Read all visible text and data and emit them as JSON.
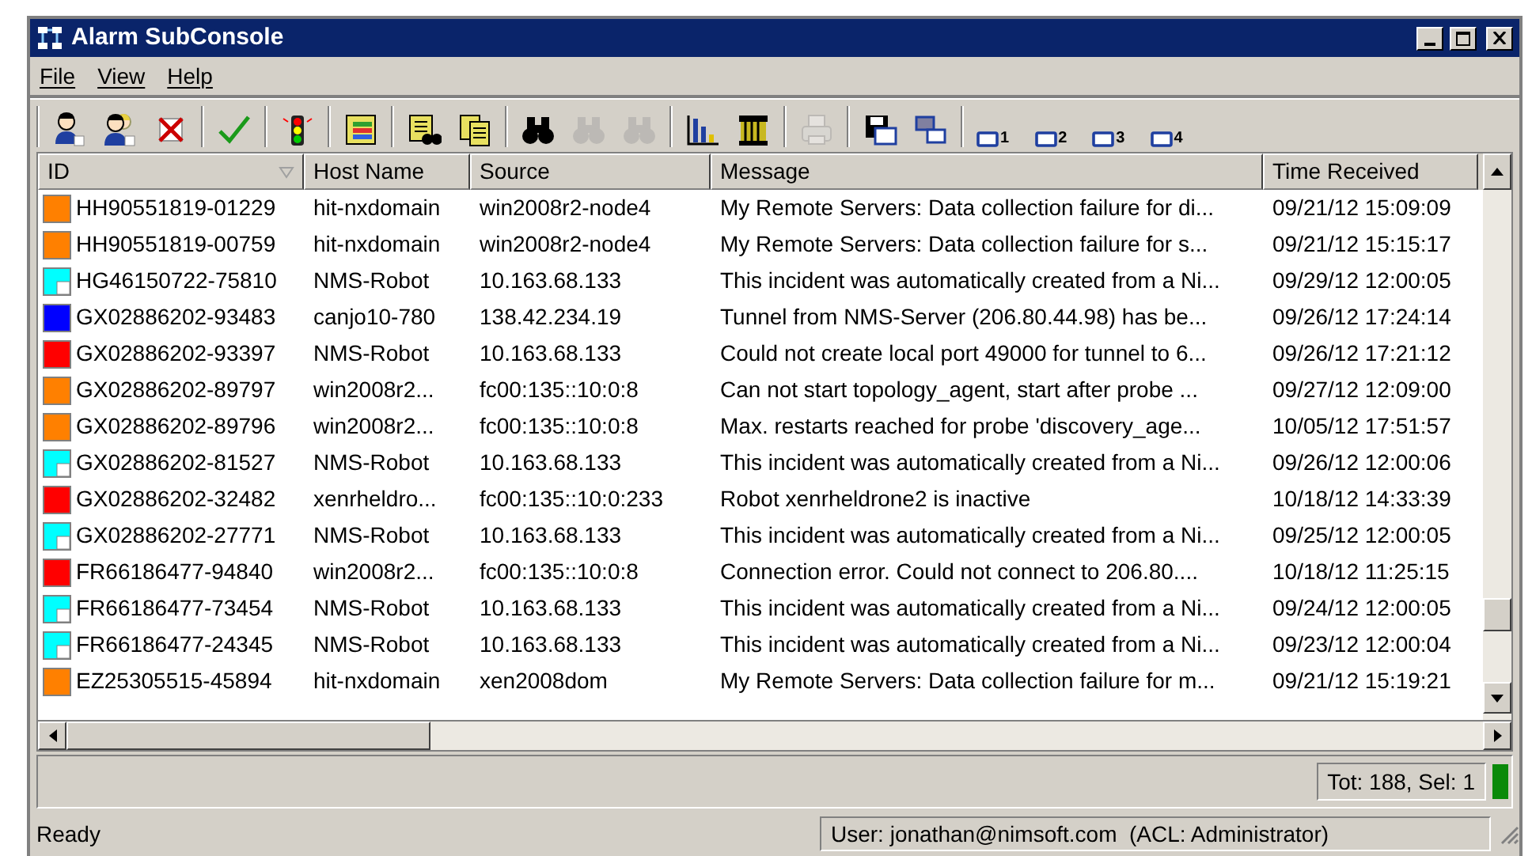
{
  "window": {
    "title": "Alarm SubConsole"
  },
  "menu": [
    "File",
    "View",
    "Help"
  ],
  "toolbar": [
    {
      "kind": "separator"
    },
    {
      "kind": "person",
      "disabled": false
    },
    {
      "kind": "people",
      "disabled": false
    },
    {
      "kind": "delete",
      "disabled": false
    },
    {
      "kind": "separator"
    },
    {
      "kind": "check",
      "disabled": false
    },
    {
      "kind": "separator"
    },
    {
      "kind": "traffic-light",
      "disabled": false
    },
    {
      "kind": "separator"
    },
    {
      "kind": "colored-list",
      "disabled": false
    },
    {
      "kind": "separator"
    },
    {
      "kind": "list-find",
      "disabled": false
    },
    {
      "kind": "lists",
      "disabled": false
    },
    {
      "kind": "separator"
    },
    {
      "kind": "binoculars",
      "disabled": false
    },
    {
      "kind": "binoculars",
      "disabled": true
    },
    {
      "kind": "binoculars",
      "disabled": true
    },
    {
      "kind": "separator"
    },
    {
      "kind": "bar-chart",
      "disabled": false
    },
    {
      "kind": "columns",
      "disabled": false
    },
    {
      "kind": "separator"
    },
    {
      "kind": "printer",
      "disabled": true
    },
    {
      "kind": "separator"
    },
    {
      "kind": "save",
      "disabled": false
    },
    {
      "kind": "windows",
      "disabled": false
    },
    {
      "kind": "separator"
    },
    {
      "kind": "window",
      "disabled": false,
      "label": "1"
    },
    {
      "kind": "window",
      "disabled": false,
      "label": "2"
    },
    {
      "kind": "window",
      "disabled": false,
      "label": "3"
    },
    {
      "kind": "window",
      "disabled": false,
      "label": "4"
    }
  ],
  "table": {
    "columns": [
      {
        "label": "ID",
        "sorted": true
      },
      {
        "label": "Host Name",
        "sorted": false
      },
      {
        "label": "Source",
        "sorted": false
      },
      {
        "label": "Message",
        "sorted": false
      },
      {
        "label": "Time Received",
        "sorted": false
      }
    ],
    "rows": [
      {
        "color": "#ff8000",
        "kind": "plain",
        "cells": [
          "HH90551819-01229",
          "hit-nxdomain",
          "win2008r2-node4",
          "My Remote Servers: Data collection failure for di...",
          "09/21/12 15:09:09"
        ]
      },
      {
        "color": "#ff8000",
        "kind": "plain",
        "cells": [
          "HH90551819-00759",
          "hit-nxdomain",
          "win2008r2-node4",
          "My Remote Servers: Data collection failure for s...",
          "09/21/12 15:15:17"
        ]
      },
      {
        "color": "#00ffff",
        "kind": "cornered",
        "cells": [
          "HG46150722-75810",
          "NMS-Robot",
          "10.163.68.133",
          "This incident was automatically created from a Ni...",
          "09/29/12 12:00:05"
        ]
      },
      {
        "color": "#0000ff",
        "kind": "plain",
        "cells": [
          "GX02886202-93483",
          "canjo10-780",
          "138.42.234.19",
          "Tunnel from NMS-Server (206.80.44.98) has be...",
          "09/26/12 17:24:14"
        ]
      },
      {
        "color": "#ff0000",
        "kind": "plain",
        "cells": [
          "GX02886202-93397",
          "NMS-Robot",
          "10.163.68.133",
          "Could not create local port 49000 for tunnel to 6...",
          "09/26/12 17:21:12"
        ]
      },
      {
        "color": "#ff8000",
        "kind": "plain",
        "cells": [
          "GX02886202-89797",
          "win2008r2...",
          "fc00:135::10:0:8",
          "Can not start topology_agent, start after probe ...",
          "09/27/12 12:09:00"
        ]
      },
      {
        "color": "#ff8000",
        "kind": "plain",
        "cells": [
          "GX02886202-89796",
          "win2008r2...",
          "fc00:135::10:0:8",
          "Max. restarts reached for probe 'discovery_age...",
          "10/05/12 17:51:57"
        ]
      },
      {
        "color": "#00ffff",
        "kind": "cornered",
        "cells": [
          "GX02886202-81527",
          "NMS-Robot",
          "10.163.68.133",
          "This incident was automatically created from a Ni...",
          "09/26/12 12:00:06"
        ]
      },
      {
        "color": "#ff0000",
        "kind": "plain",
        "cells": [
          "GX02886202-32482",
          "xenrheldro...",
          "fc00:135::10:0:233",
          "Robot xenrheldrone2 is inactive",
          "10/18/12 14:33:39"
        ]
      },
      {
        "color": "#00ffff",
        "kind": "cornered",
        "cells": [
          "GX02886202-27771",
          "NMS-Robot",
          "10.163.68.133",
          "This incident was automatically created from a Ni...",
          "09/25/12 12:00:05"
        ]
      },
      {
        "color": "#ff0000",
        "kind": "plain",
        "cells": [
          "FR66186477-94840",
          "win2008r2...",
          "fc00:135::10:0:8",
          "Connection error. Could not connect to 206.80....",
          "10/18/12 11:25:15"
        ]
      },
      {
        "color": "#00ffff",
        "kind": "cornered",
        "cells": [
          "FR66186477-73454",
          "NMS-Robot",
          "10.163.68.133",
          "This incident was automatically created from a Ni...",
          "09/24/12 12:00:05"
        ]
      },
      {
        "color": "#00ffff",
        "kind": "cornered",
        "cells": [
          "FR66186477-24345",
          "NMS-Robot",
          "10.163.68.133",
          "This incident was automatically created from a Ni...",
          "09/23/12 12:00:04"
        ]
      },
      {
        "color": "#ff8000",
        "kind": "plain",
        "cells": [
          "EZ25305515-45894",
          "hit-nxdomain",
          "xen2008dom",
          "My Remote Servers: Data collection failure for m...",
          "09/21/12 15:19:21"
        ]
      }
    ]
  },
  "totals": "Tot: 188,  Sel: 1",
  "status_bar": {
    "message": "Ready",
    "user": "User: jonathan@nimsoft.com  (ACL: Administrator)"
  }
}
